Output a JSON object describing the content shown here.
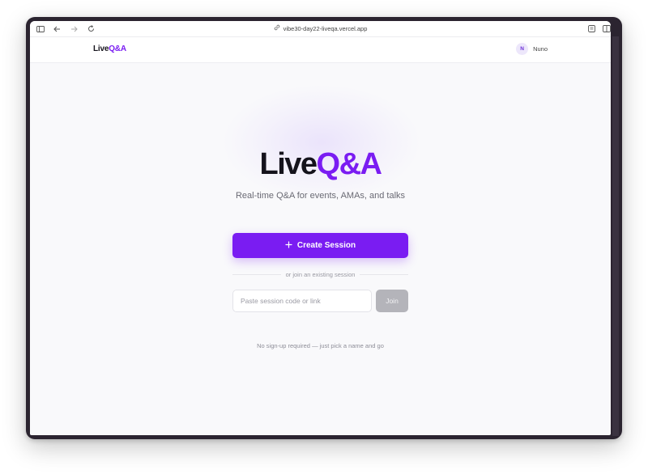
{
  "browser": {
    "url": "vibe30-day22-liveqa.vercel.app"
  },
  "header": {
    "logo_part1": "Live",
    "logo_part2": "Q&A",
    "user_initial": "N",
    "user_name": "Nuno"
  },
  "hero": {
    "title_part1": "Live",
    "title_part2": "Q&A",
    "tagline": "Real-time Q&A for events, AMAs, and talks"
  },
  "actions": {
    "create_label": "Create Session",
    "divider_text": "or join an existing session",
    "input_placeholder": "Paste session code or link",
    "input_value": "",
    "join_label": "Join"
  },
  "footer": {
    "note": "No sign-up required — just pick a name and go"
  },
  "colors": {
    "accent": "#7a1cf2",
    "text_dark": "#15131c",
    "join_disabled": "#b4b4ba"
  }
}
